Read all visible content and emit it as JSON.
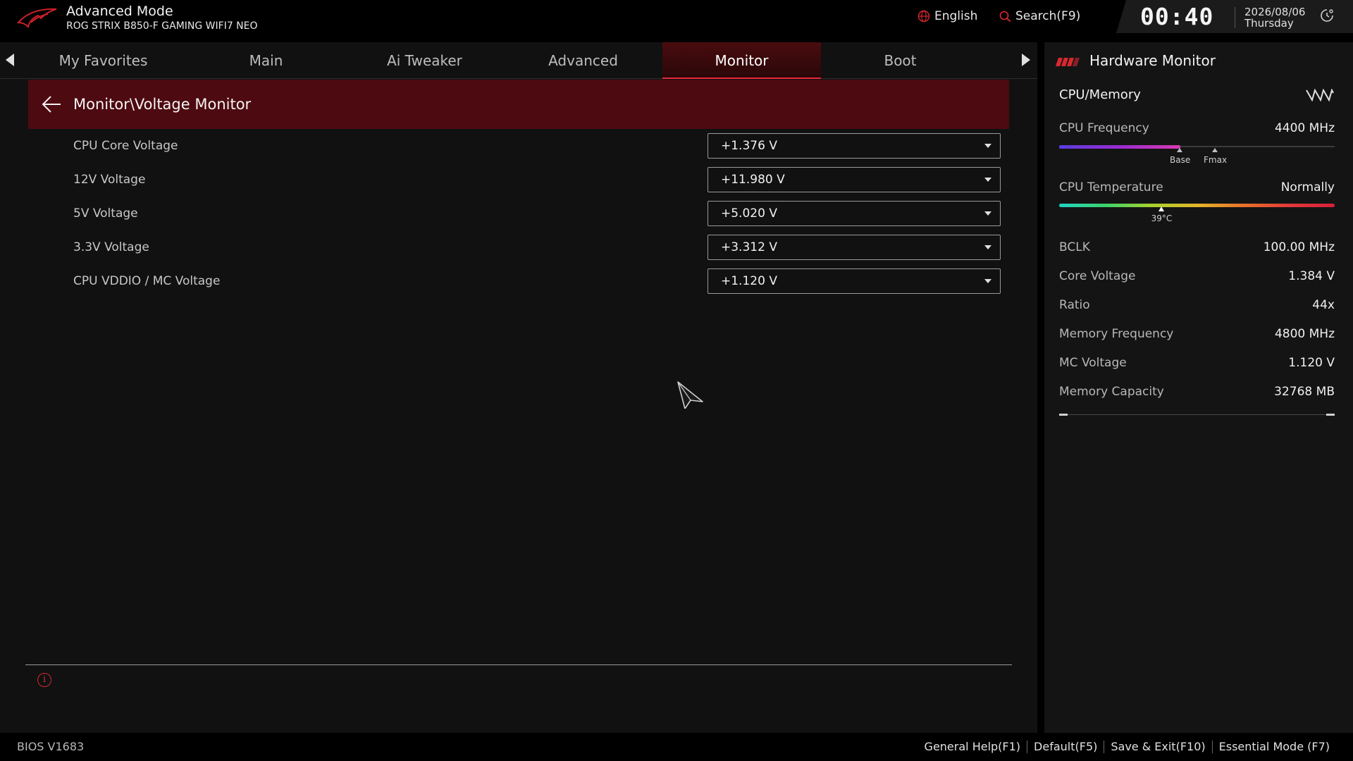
{
  "header": {
    "mode_title": "Advanced Mode",
    "board_name": "ROG STRIX B850-F GAMING WIFI7 NEO",
    "language": "English",
    "search_label": "Search(F9)",
    "time": "00:40",
    "date": "2026/08/06",
    "weekday": "Thursday"
  },
  "tabs": [
    {
      "label": "My Favorites",
      "active": false
    },
    {
      "label": "Main",
      "active": false
    },
    {
      "label": "Ai Tweaker",
      "active": false
    },
    {
      "label": "Advanced",
      "active": false
    },
    {
      "label": "Monitor",
      "active": true
    },
    {
      "label": "Boot",
      "active": false
    }
  ],
  "breadcrumb": "Monitor\\Voltage Monitor",
  "voltages": [
    {
      "label": "CPU Core Voltage",
      "value": "+1.376 V"
    },
    {
      "label": "12V Voltage",
      "value": "+11.980 V"
    },
    {
      "label": "5V Voltage",
      "value": "+5.020 V"
    },
    {
      "label": "3.3V Voltage",
      "value": "+3.312 V"
    },
    {
      "label": "CPU VDDIO / MC Voltage",
      "value": "+1.120 V"
    }
  ],
  "hardware_monitor": {
    "title": "Hardware Monitor",
    "section": "CPU/Memory",
    "cpu_frequency": {
      "label": "CPU Frequency",
      "value": "4400 MHz",
      "fill_fraction": 0.44,
      "base_label": "Base",
      "fmax_label": "Fmax"
    },
    "cpu_temperature": {
      "label": "CPU Temperature",
      "value": "Normally",
      "reading": "39°C",
      "level_fraction": 0.37
    },
    "rows": [
      {
        "label": "BCLK",
        "value": "100.00 MHz"
      },
      {
        "label": "Core Voltage",
        "value": "1.384 V"
      },
      {
        "label": "Ratio",
        "value": "44x"
      },
      {
        "label": "Memory Frequency",
        "value": "4800 MHz"
      },
      {
        "label": "MC Voltage",
        "value": "1.120 V"
      },
      {
        "label": "Memory Capacity",
        "value": "32768 MB"
      }
    ]
  },
  "footer": {
    "bios_version": "BIOS V1683",
    "actions": [
      "General Help(F1)",
      "Default(F5)",
      "Save & Exit(F10)",
      "Essential Mode (F7)"
    ]
  },
  "colors": {
    "accent_red": "#e8283a",
    "breadcrumb_bg": "#4d0a10",
    "active_tab_bg": "#4a0c0f"
  }
}
